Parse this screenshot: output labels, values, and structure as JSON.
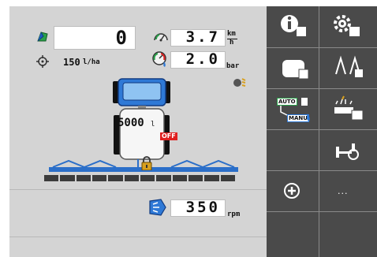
{
  "status": {
    "volume_rate": "0",
    "target_rate": "150",
    "target_rate_unit": "l/ha",
    "speed": "3.7",
    "speed_unit_top": "km",
    "speed_unit_bottom": "h",
    "pressure": "2.0",
    "pressure_unit": "bar"
  },
  "sprayer": {
    "tank_volume": "5000",
    "tank_unit": "l",
    "off_label": "OFF",
    "boom_sections": 12
  },
  "pto": {
    "value": "350",
    "unit": "rpm"
  },
  "softkeys": {
    "auto_label": "AUTO",
    "manu_label": "MANU",
    "more_label": "..."
  },
  "colors": {
    "screen_bg": "#d4d4d4",
    "softkey_bg": "#4a4a4a",
    "tractor_blue": "#2f79d6",
    "boom_blue": "#2b6fc9",
    "off_red": "#e02020",
    "lock_gold": "#d8a020",
    "rate_green": "#2aa04a"
  }
}
